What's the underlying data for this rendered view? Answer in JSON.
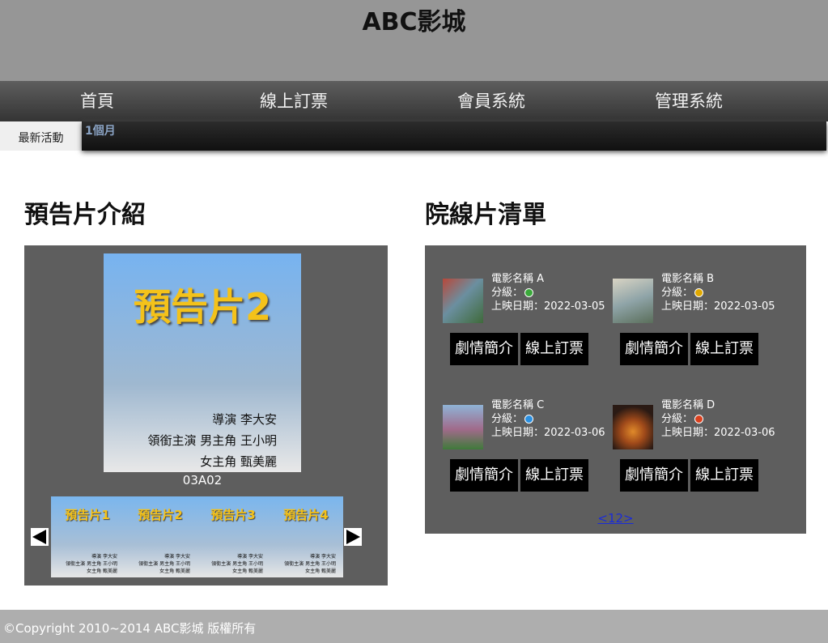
{
  "site": {
    "title": "ABC影城"
  },
  "nav": {
    "items": [
      "首頁",
      "線上訂票",
      "會員系統",
      "管理系統"
    ]
  },
  "marquee": {
    "label": "最新活動",
    "text": "1個月"
  },
  "trailers": {
    "section_title": "預告片介紹",
    "main": {
      "title": "預告片2",
      "credit_director": "導演  李大安",
      "credit_lead": "領銜主演  男主角 王小明",
      "credit_lead2": "女主角 甄美麗",
      "code": "03A02"
    },
    "thumbnails": [
      {
        "title": "預告片1"
      },
      {
        "title": "預告片2"
      },
      {
        "title": "預告片3"
      },
      {
        "title": "預告片4"
      }
    ],
    "thumb_credit_director": "導演 李大安",
    "thumb_credit_lead": "領銜主演 男主角 王小明",
    "thumb_credit_lead2": "女主角 甄美麗"
  },
  "movies": {
    "section_title": "院線片清單",
    "rating_label": "分級：",
    "release_label": "上映日期：",
    "synopsis_label": "劇情簡介",
    "booking_label": "線上訂票",
    "items": [
      {
        "name": "電影名稱 A",
        "release_date": "2022-03-05",
        "rating_icon": "rating-general-icon",
        "rating_color": "#3aa83a"
      },
      {
        "name": "電影名稱 B",
        "release_date": "2022-03-05",
        "rating_icon": "rating-guidance-icon",
        "rating_color": "#e0a800"
      },
      {
        "name": "電影名稱 C",
        "release_date": "2022-03-06",
        "rating_icon": "rating-protected-icon",
        "rating_color": "#2a8fe0"
      },
      {
        "name": "電影名稱 D",
        "release_date": "2022-03-06",
        "rating_icon": "rating-restricted-icon",
        "rating_color": "#d9401e"
      }
    ],
    "pager": "<12>"
  },
  "footer": {
    "text": "©Copyright 2010~2014 ABC影城 版權所有"
  }
}
